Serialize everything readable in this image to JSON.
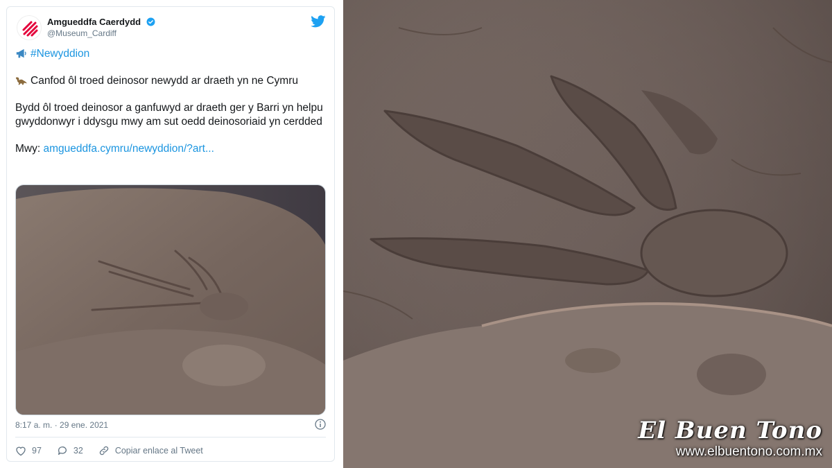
{
  "tweet": {
    "author_name": "Amgueddfa Caerdydd",
    "author_handle": "@Museum_Cardiff",
    "hashtag_line": "#Newyddion",
    "headline": "Canfod ôl troed deinosor newydd ar draeth yn ne Cymru",
    "body": "Bydd ôl troed deinosor a ganfuwyd ar draeth ger y Barri yn helpu gwyddonwyr i ddysgu mwy am sut oedd deinosoriaid yn cerdded",
    "more_label": "Mwy:",
    "more_link": "amgueddfa.cymru/newyddion/?art...",
    "timestamp": "8:17 a. m. · 29 ene. 2021",
    "likes": "97",
    "replies": "32",
    "copy_link_label": "Copiar enlace al Tweet",
    "icons": [
      "verified-badge-icon",
      "twitter-bird-icon",
      "megaphone-icon",
      "dinosaur-icon",
      "info-icon",
      "heart-icon",
      "reply-icon",
      "link-icon"
    ],
    "colors": {
      "link": "#1b95e0",
      "text": "#14171a",
      "muted": "#657786",
      "brand": "#1da1f2"
    }
  },
  "watermark": {
    "title": "El Buen Tono",
    "url": "www.elbuentono.com.mx"
  }
}
